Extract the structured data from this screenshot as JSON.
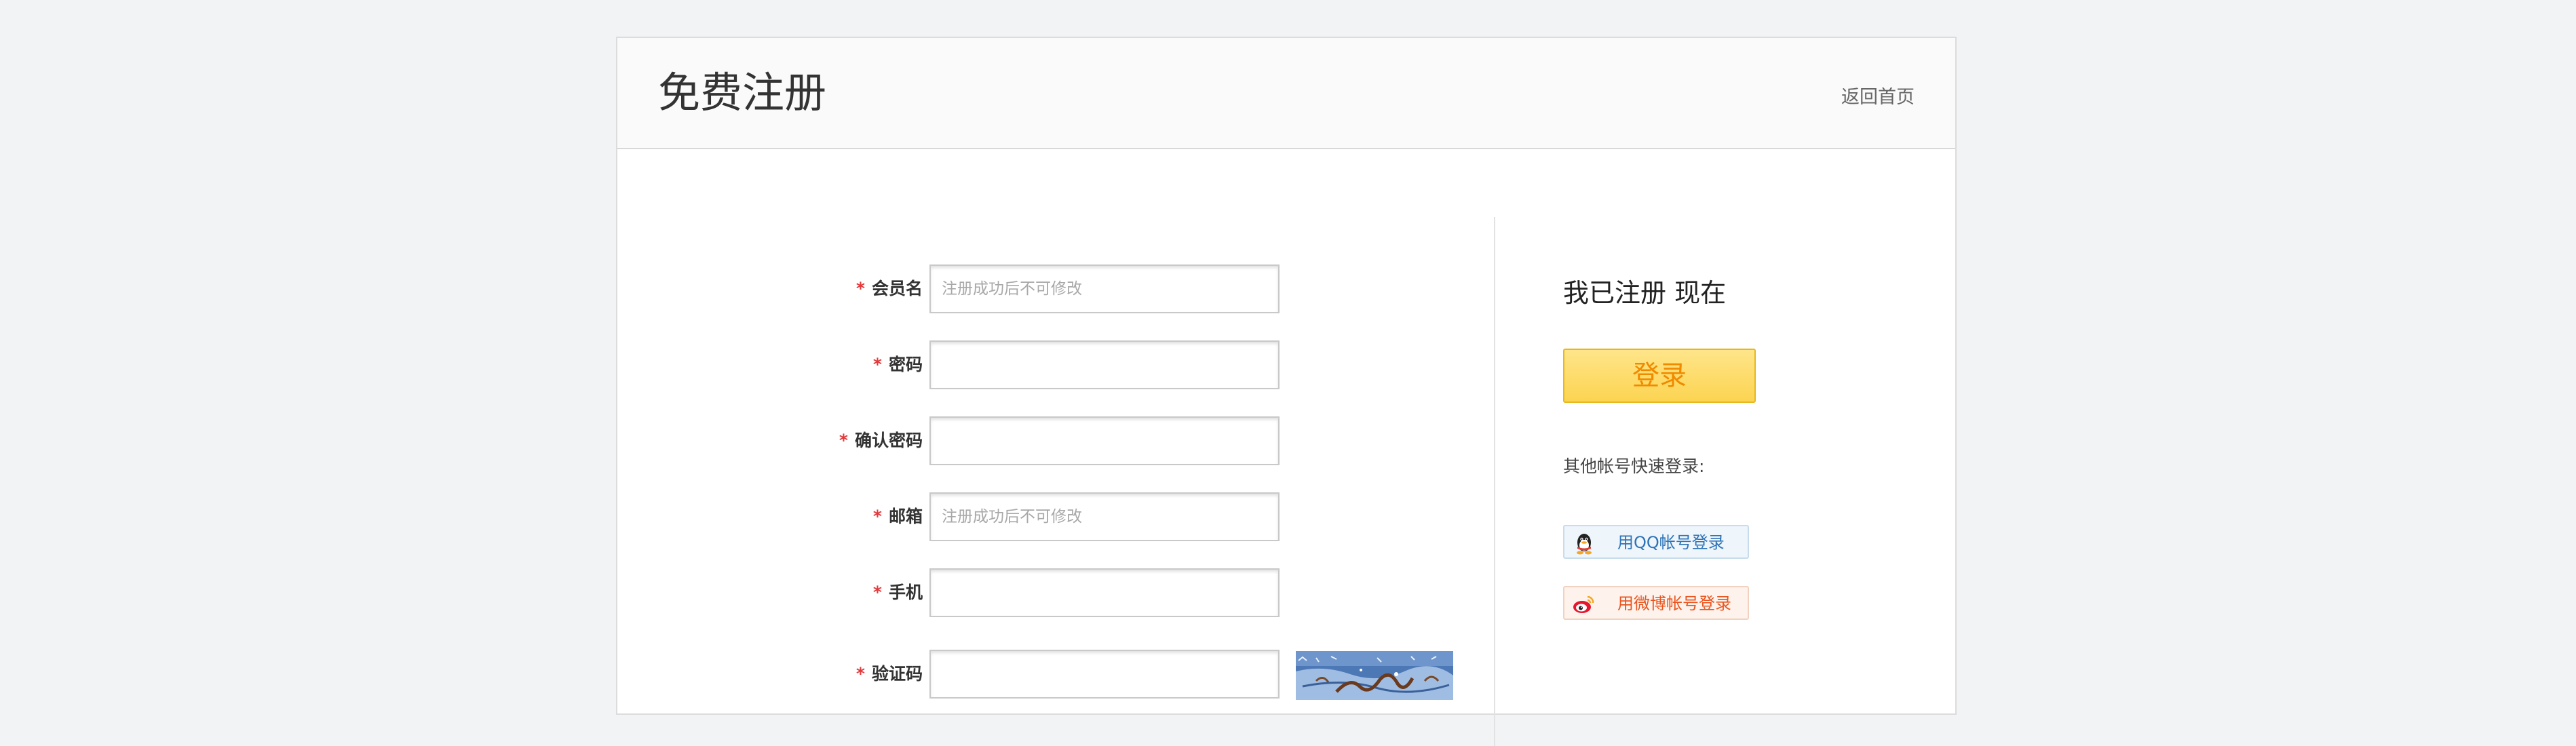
{
  "header": {
    "title": "免费注册",
    "home_link": "返回首页"
  },
  "form": {
    "required_mark": "*",
    "fields": [
      {
        "label": "会员名",
        "placeholder": "注册成功后不可修改",
        "value": ""
      },
      {
        "label": "密码",
        "placeholder": "",
        "value": ""
      },
      {
        "label": "确认密码",
        "placeholder": "",
        "value": ""
      },
      {
        "label": "邮箱",
        "placeholder": "注册成功后不可修改",
        "value": ""
      },
      {
        "label": "手机",
        "placeholder": "",
        "value": ""
      },
      {
        "label": "验证码",
        "placeholder": "",
        "value": ""
      }
    ]
  },
  "side": {
    "title": "我已注册 现在",
    "login_button": "登录",
    "quick_login_label": "其他帐号快速登录:",
    "qq_button": "用QQ帐号登录",
    "weibo_button": "用微博帐号登录"
  },
  "colors": {
    "required": "#e4393c",
    "login_text": "#f08a00",
    "qq_text": "#2d73b7",
    "weibo_text": "#e9541e"
  },
  "icons": {
    "qq": "qq-penguin-icon",
    "weibo": "weibo-eye-icon"
  }
}
